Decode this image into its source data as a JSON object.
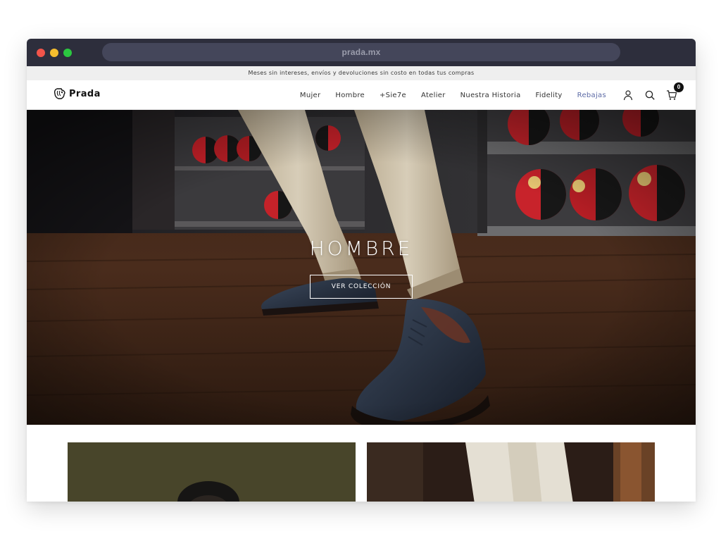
{
  "browser": {
    "url": "prada.mx"
  },
  "promo_bar": {
    "text": "Meses sin intereses, envíos y devoluciones sin costo en todas tus compras"
  },
  "header": {
    "logo_text": "Prada",
    "nav": [
      {
        "label": "Mujer"
      },
      {
        "label": "Hombre"
      },
      {
        "label": "+Sie7e"
      },
      {
        "label": "Atelier"
      },
      {
        "label": "Nuestra Historia"
      },
      {
        "label": "Fidelity"
      },
      {
        "label": "Rebajas"
      }
    ],
    "cart_count": "0",
    "icons": [
      "user-icon",
      "search-icon",
      "cart-icon"
    ]
  },
  "hero": {
    "title": "HOMBRE",
    "button_label": "VER COLECCIÓN"
  },
  "colors": {
    "titlebar": "#2d2e3c",
    "urlbar": "#44465a",
    "sale_link": "#5c6aa5",
    "promo_bg": "#efefef"
  }
}
